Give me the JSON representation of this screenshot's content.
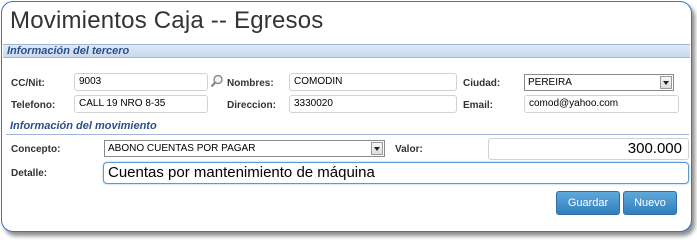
{
  "title": "Movimientos Caja -- Egresos",
  "sections": {
    "tercero": "Información del tercero",
    "movimiento": "Información del movimiento"
  },
  "tercero": {
    "ccnit_label": "CC/Nit:",
    "ccnit_value": "9003",
    "nombres_label": "Nombres:",
    "nombres_value": "COMODIN",
    "ciudad_label": "Ciudad:",
    "ciudad_value": "PEREIRA",
    "telefono_label": "Telefono:",
    "telefono_value": "CALL 19 NRO 8-35",
    "direccion_label": "Direccion:",
    "direccion_value": "3330020",
    "email_label": "Email:",
    "email_value": "comod@yahoo.com"
  },
  "movimiento": {
    "concepto_label": "Concepto:",
    "concepto_value": "ABONO CUENTAS POR PAGAR",
    "valor_label": "Valor:",
    "valor_value": "300.000",
    "detalle_label": "Detalle:",
    "detalle_value": "Cuentas por mantenimiento de máquina"
  },
  "buttons": {
    "guardar": "Guardar",
    "nuevo": "Nuevo"
  },
  "icons": {
    "lookup": "magnifier-icon",
    "dropdown": "chevron-down-icon"
  },
  "colors": {
    "accent": "#2f7fbf",
    "section_text": "#2c4f8a",
    "window_border": "#3f6fcf"
  }
}
